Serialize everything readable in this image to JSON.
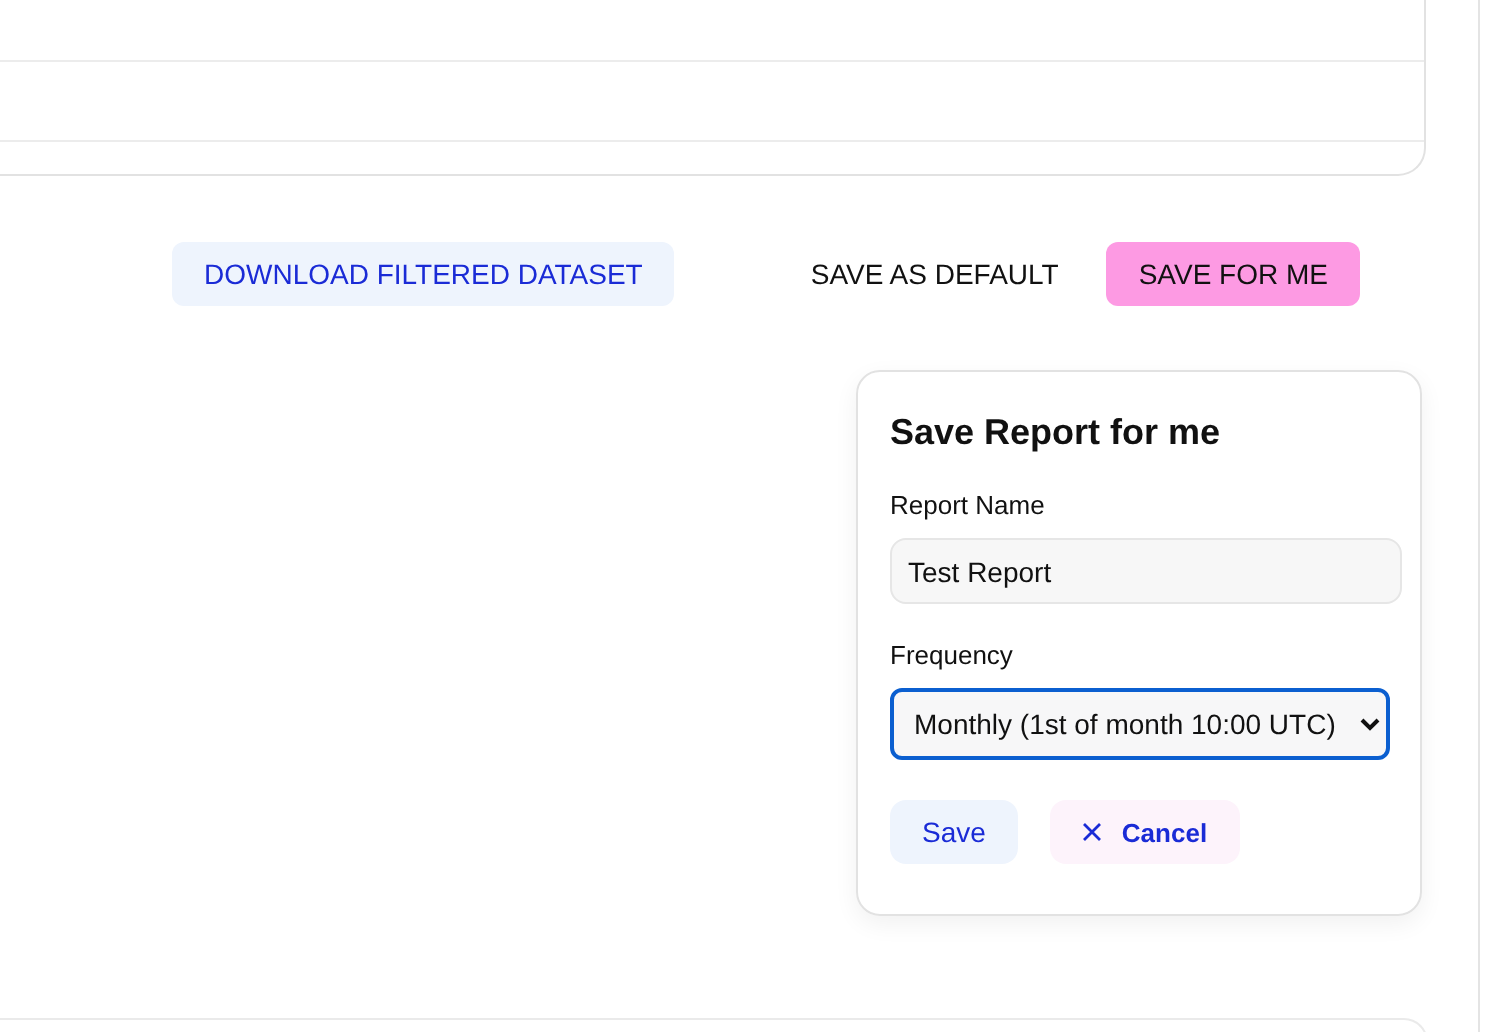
{
  "toolbar": {
    "buttons": [
      {
        "label": "DOWNLOAD FILTERED DATASET",
        "kind": "download"
      },
      {
        "label": "SAVE AS DEFAULT",
        "kind": "plain"
      },
      {
        "label": "SAVE FOR ME",
        "kind": "primary"
      }
    ]
  },
  "dialog": {
    "title": "Save Report for me",
    "fields": [
      {
        "label": "Report Name",
        "kind": "text",
        "value": "Test Report",
        "focused": false
      },
      {
        "label": "Frequency",
        "kind": "select",
        "value": "Monthly (1st of month 10:00 UTC)",
        "focused": true
      }
    ],
    "actions": [
      {
        "label": "Save",
        "kind": "save"
      },
      {
        "label": "Cancel",
        "kind": "cancel"
      }
    ]
  }
}
